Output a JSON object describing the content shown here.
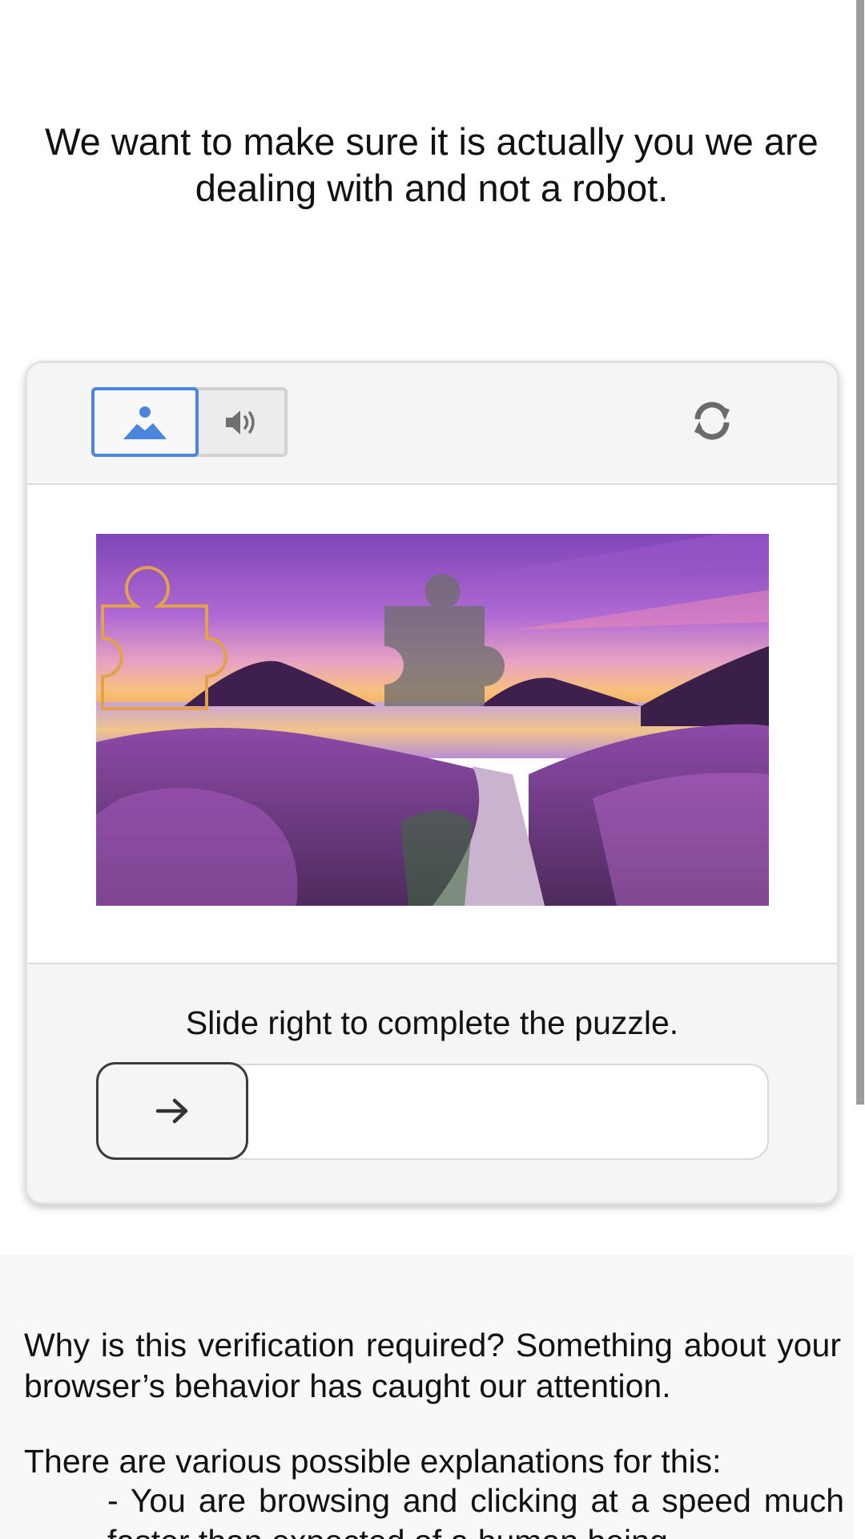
{
  "intro": {
    "message": "We want to make sure it is actually you we are dealing with and not a robot."
  },
  "captcha": {
    "modes": {
      "image_icon": "image-mode-icon",
      "audio_icon": "speaker-icon",
      "selected": "image"
    },
    "refresh_icon": "refresh-icon",
    "instruction": "Slide right to complete the puzzle.",
    "slider": {
      "handle_icon": "arrow-right-icon",
      "progress": 0
    },
    "colors": {
      "accent": "#4a86db",
      "piece_outline": "#e0a24a",
      "piece_target": "#6e6e6e"
    }
  },
  "info": {
    "why": "Why is this verification required? Something about your browser’s behavior has caught our attention.",
    "reasons_intro": "There are various possible explanations for this:",
    "reasons": [
      "- You are browsing and clicking at a speed much faster than expected of a human being."
    ]
  }
}
